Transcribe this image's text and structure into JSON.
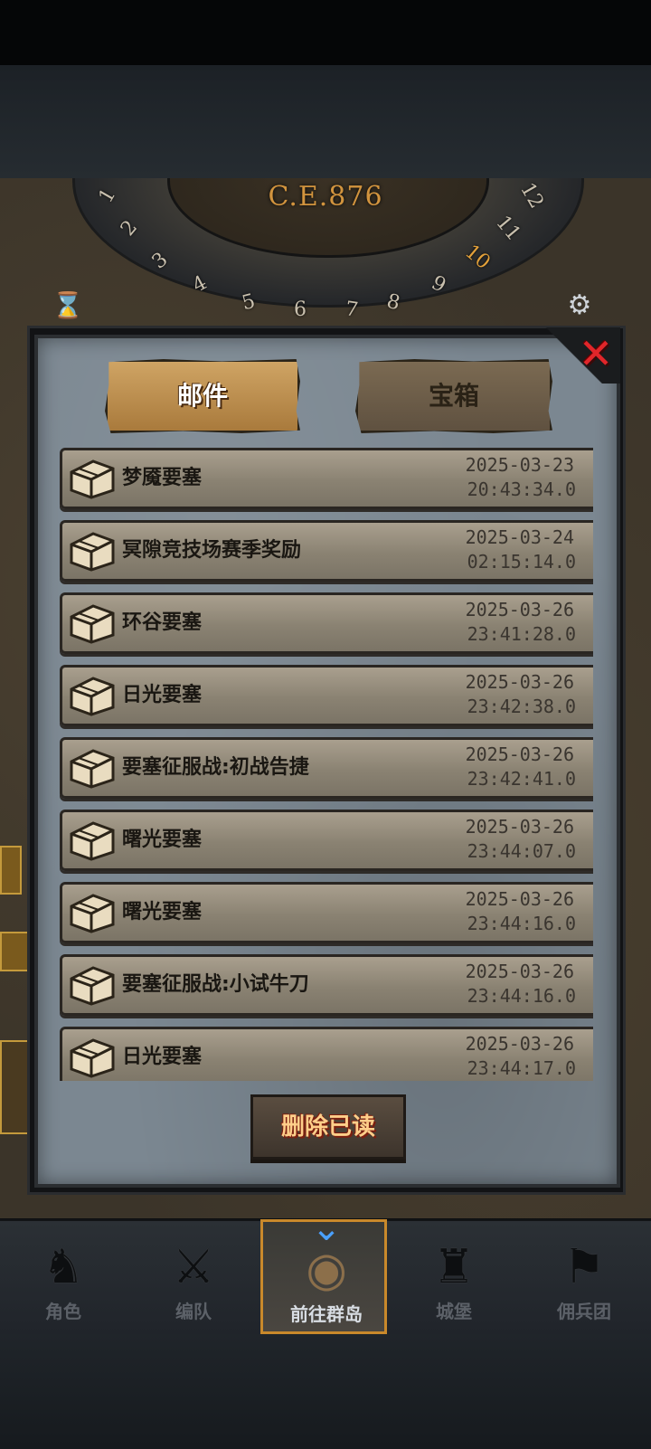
{
  "header": {
    "era": "C.E.876"
  },
  "dial": {
    "numbers": [
      "1",
      "2",
      "3",
      "4",
      "5",
      "6",
      "7",
      "8",
      "9",
      "10",
      "11",
      "12"
    ],
    "highlight": "10"
  },
  "dialog": {
    "tabs": [
      {
        "label": "邮件",
        "active": true
      },
      {
        "label": "宝箱",
        "active": false
      }
    ],
    "close_icon": "close-x-icon",
    "mails": [
      {
        "title": "梦魇要塞",
        "date": "2025-03-23",
        "time": "20:43:34.0"
      },
      {
        "title": "冥隙竞技场赛季奖励",
        "date": "2025-03-24",
        "time": "02:15:14.0"
      },
      {
        "title": "环谷要塞",
        "date": "2025-03-26",
        "time": "23:41:28.0"
      },
      {
        "title": "日光要塞",
        "date": "2025-03-26",
        "time": "23:42:38.0"
      },
      {
        "title": "要塞征服战:初战告捷",
        "date": "2025-03-26",
        "time": "23:42:41.0"
      },
      {
        "title": "曙光要塞",
        "date": "2025-03-26",
        "time": "23:44:07.0"
      },
      {
        "title": "曙光要塞",
        "date": "2025-03-26",
        "time": "23:44:16.0"
      },
      {
        "title": "要塞征服战:小试牛刀",
        "date": "2025-03-26",
        "time": "23:44:16.0"
      },
      {
        "title": "日光要塞",
        "date": "2025-03-26",
        "time": "23:44:17.0"
      }
    ],
    "delete_read_label": "删除已读"
  },
  "nav": {
    "items": [
      {
        "label": "角色",
        "icon": "knight-icon",
        "active": false
      },
      {
        "label": "编队",
        "icon": "squad-icon",
        "active": false
      },
      {
        "label": "前往群岛",
        "icon": "globe-icon",
        "active": true
      },
      {
        "label": "城堡",
        "icon": "castle-icon",
        "active": false
      },
      {
        "label": "佣兵团",
        "icon": "mercenary-icon",
        "active": false
      }
    ]
  },
  "colors": {
    "accent_gold": "#c9892b",
    "close_red": "#e1262a",
    "delete_text": "#ffcf8a",
    "nav_arrow": "#4aa0ff"
  }
}
